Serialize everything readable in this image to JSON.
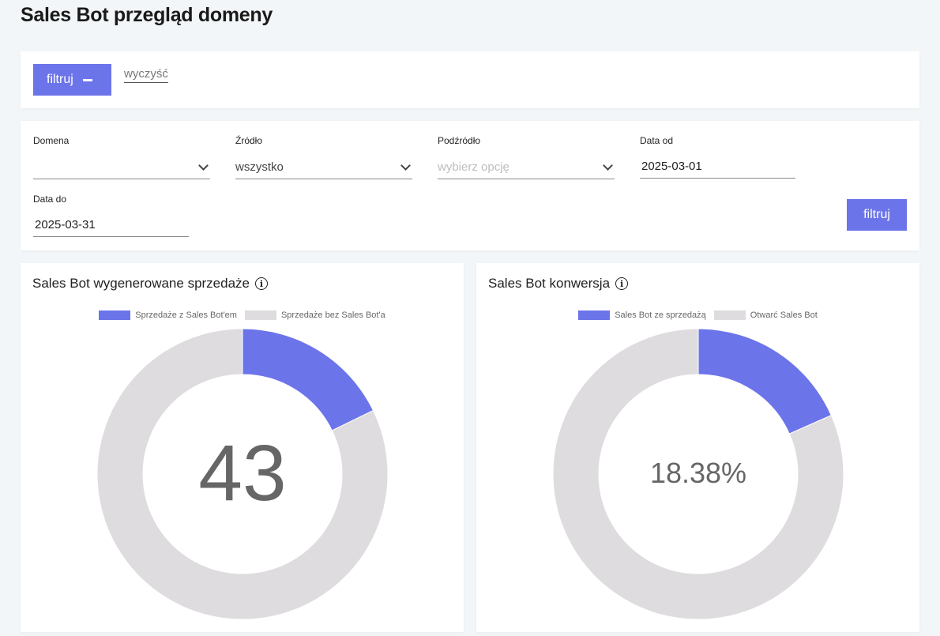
{
  "page": {
    "title": "Sales Bot przegląd domeny"
  },
  "filter_bar": {
    "toggle_label": "filtruj",
    "clear_label": "wyczyść"
  },
  "filters": {
    "domain": {
      "label": "Domena",
      "value": ""
    },
    "source": {
      "label": "Źródło",
      "value": "wszystko"
    },
    "subsource": {
      "label": "Podźródło",
      "placeholder": "wybierz opcję"
    },
    "date_from": {
      "label": "Data od",
      "value": "2025-03-01"
    },
    "date_to": {
      "label": "Data do",
      "value": "2025-03-31"
    },
    "submit_label": "filtruj"
  },
  "colors": {
    "accent": "#6c74ea",
    "ring_bg": "#dedcde",
    "page_bg": "#f2f6f8"
  },
  "icons": {
    "info": "info-icon",
    "chevron": "chevron-down-icon",
    "minus": "minus-icon"
  },
  "chart_data": [
    {
      "type": "pie",
      "title": "Sales Bot wygenerowane sprzedaże",
      "center_label": "43",
      "legend": [
        "Sprzedaże z Sales Bot'em",
        "Sprzedaże bez Sales Bot'a"
      ],
      "slices": [
        {
          "name": "Sprzedaże z Sales Bot'em",
          "fraction": 0.178,
          "color": "#6c74ea"
        },
        {
          "name": "Sprzedaże bez Sales Bot'a",
          "fraction": 0.822,
          "color": "#dedcde"
        }
      ]
    },
    {
      "type": "pie",
      "title": "Sales Bot konwersja",
      "center_label": "18.38%",
      "legend": [
        "Sales Bot ze sprzedażą",
        "Otwarć Sales Bot"
      ],
      "slices": [
        {
          "name": "Sales Bot ze sprzedażą",
          "fraction": 0.1838,
          "color": "#6c74ea"
        },
        {
          "name": "Otwarć Sales Bot",
          "fraction": 0.8162,
          "color": "#dedcde"
        }
      ]
    }
  ]
}
